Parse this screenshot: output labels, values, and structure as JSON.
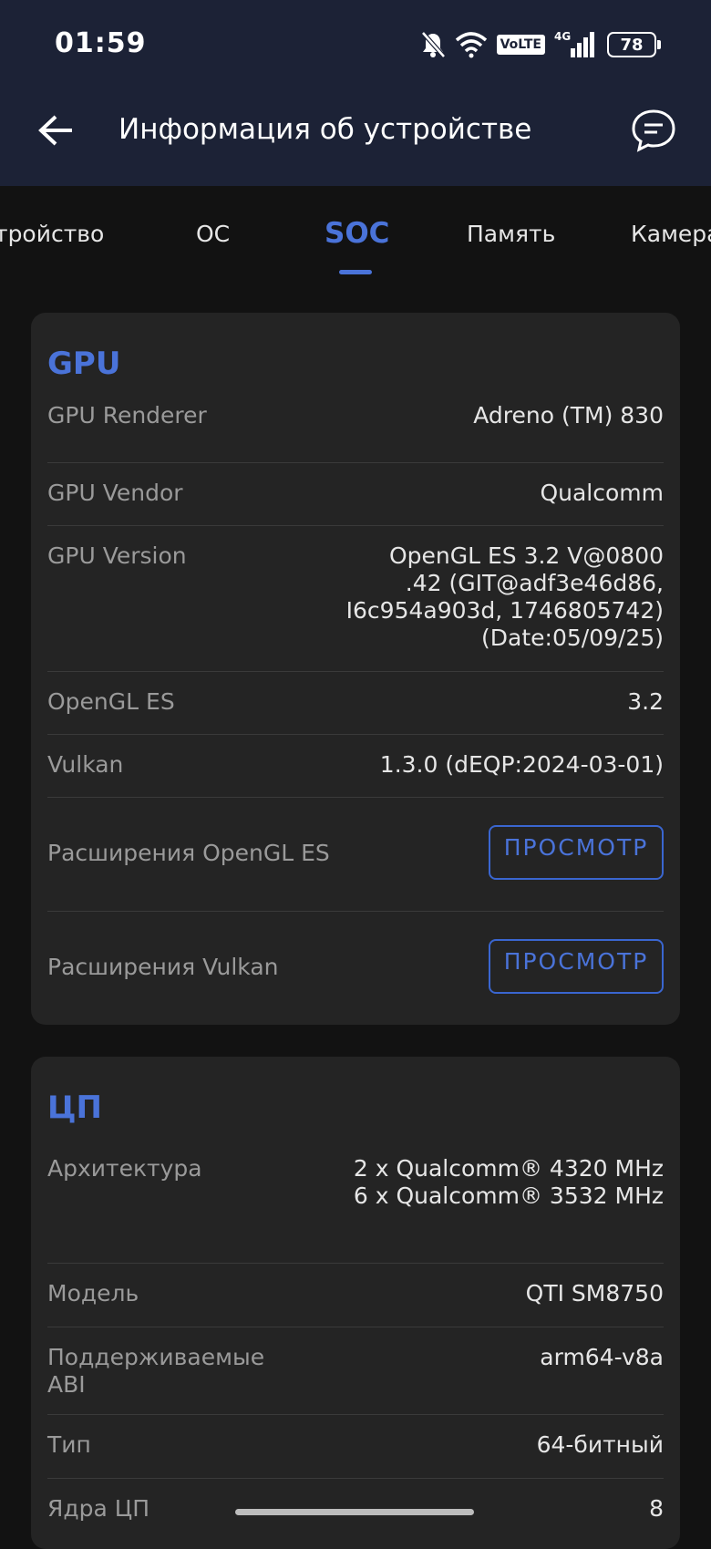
{
  "status_bar": {
    "time": "01:59",
    "volte": "VoLTE",
    "network": "4G",
    "battery": "78",
    "icons": [
      "mute-icon",
      "wifi-icon",
      "volte-icon",
      "signal-icon",
      "battery-icon"
    ]
  },
  "header": {
    "title": "Информация об устройстве",
    "back_icon": "arrow-left-icon",
    "chat_icon": "chat-bubble-icon"
  },
  "tabs": [
    {
      "label": "тройство",
      "active": false
    },
    {
      "label": "ОС",
      "active": false
    },
    {
      "label": "SOC",
      "active": true
    },
    {
      "label": "Память",
      "active": false
    },
    {
      "label": "Камера",
      "active": false
    }
  ],
  "gpu": {
    "title": "GPU",
    "renderer_label": "GPU Renderer",
    "renderer_value": "Adreno (TM) 830",
    "vendor_label": "GPU Vendor",
    "vendor_value": "Qualcomm",
    "version_label": "GPU Version",
    "version_value": "OpenGL ES 3.2 V@0800\n.42 (GIT@adf3e46d86,\nI6c954a903d, 1746805742)\n(Date:05/09/25)",
    "opengl_label": "OpenGL ES",
    "opengl_value": "3.2",
    "vulkan_label": "Vulkan",
    "vulkan_value": "1.3.0 (dEQP:2024-03-01)",
    "gl_ext_label": "Расширения OpenGL ES",
    "vk_ext_label": "Расширения Vulkan",
    "view_button": "ПРОСМОТР"
  },
  "cpu": {
    "title": "ЦП",
    "arch_label": "Архитектура",
    "arch_value": "2 x Qualcomm® 4320 MHz\n6 x Qualcomm® 3532 MHz",
    "model_label": "Модель",
    "model_value": "QTI SM8750",
    "abi_label": "Поддерживаемые\nABI",
    "abi_value": "arm64-v8a",
    "type_label": "Тип",
    "type_value": "64-битный",
    "cores_label": "Ядра ЦП",
    "cores_value": "8"
  },
  "colors": {
    "accent": "#4a73d9",
    "header_bg": "#1c2236",
    "card_bg": "#242424",
    "page_bg": "#121212"
  }
}
